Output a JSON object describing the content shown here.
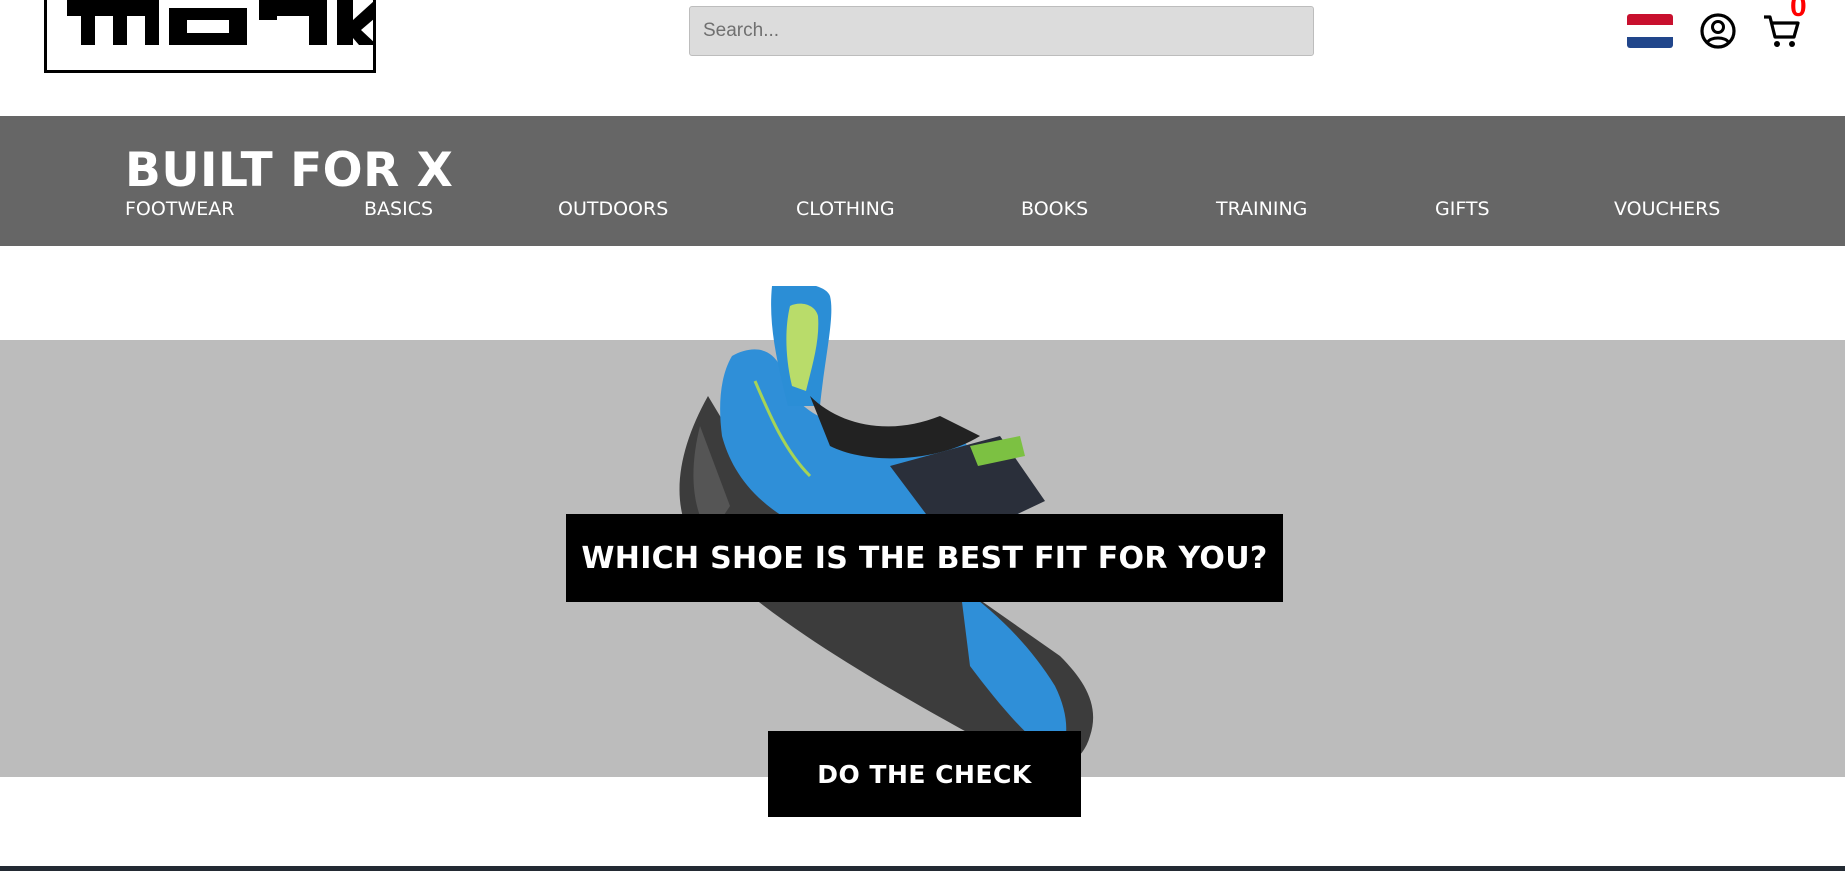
{
  "header": {
    "logo_text": "monk",
    "search_placeholder": "Search...",
    "flag_icon": "netherlands-flag-icon",
    "account_icon": "user-circle-icon",
    "cart_icon": "shopping-cart-icon",
    "cart_count": "0"
  },
  "nav": {
    "brand": "BUILT FOR X",
    "items": [
      {
        "label": "FOOTWEAR"
      },
      {
        "label": "BASICS"
      },
      {
        "label": "OUTDOORS"
      },
      {
        "label": "CLOTHING"
      },
      {
        "label": "BOOKS"
      },
      {
        "label": "TRAINING"
      },
      {
        "label": "GIFTS"
      },
      {
        "label": "VOUCHERS"
      }
    ]
  },
  "hero": {
    "headline": "WHICH SHOE IS THE BEST FIT FOR YOU?",
    "cta_label": "DO THE CHECK",
    "image": "climbing-shoe-image"
  },
  "colors": {
    "nav_background": "#666666",
    "hero_background": "#bcbcbc",
    "cart_count": "#ff0000",
    "shoe_blue": "#2f8fd8"
  }
}
